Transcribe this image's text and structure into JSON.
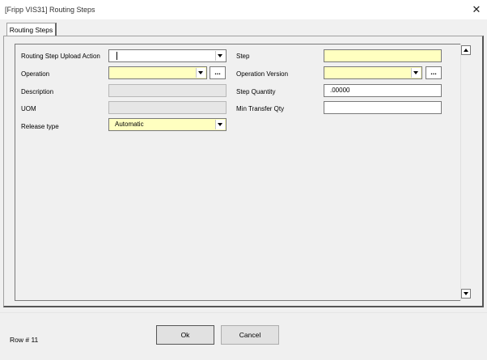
{
  "window": {
    "title": "[Fripp VIS31] Routing Steps"
  },
  "tabs": [
    {
      "label": "Routing Steps"
    }
  ],
  "left": {
    "upload_action": {
      "label": "Routing Step Upload Action",
      "value": ""
    },
    "operation": {
      "label": "Operation",
      "value": "",
      "browse": "..."
    },
    "description": {
      "label": "Description",
      "value": ""
    },
    "uom": {
      "label": "UOM",
      "value": ""
    },
    "release_type": {
      "label": "Release type",
      "value": "Automatic"
    }
  },
  "right": {
    "step": {
      "label": "Step",
      "value": ""
    },
    "operation_version": {
      "label": "Operation Version",
      "value": "",
      "browse": "..."
    },
    "step_quantity": {
      "label": "Step Quantity",
      "value": ".00000"
    },
    "min_transfer_qty": {
      "label": "Min Transfer Qty",
      "value": ""
    }
  },
  "footer": {
    "row_indicator": "Row # 11",
    "ok_label": "Ok",
    "cancel_label": "Cancel"
  },
  "colors": {
    "required_field": "#ffffc0",
    "disabled_field": "#e6e6e6",
    "background": "#f0f0f0"
  },
  "icons": {
    "close": "close-icon",
    "dropdown": "chevron-down-icon",
    "scroll_up": "scroll-up-icon",
    "scroll_down": "scroll-down-icon"
  }
}
